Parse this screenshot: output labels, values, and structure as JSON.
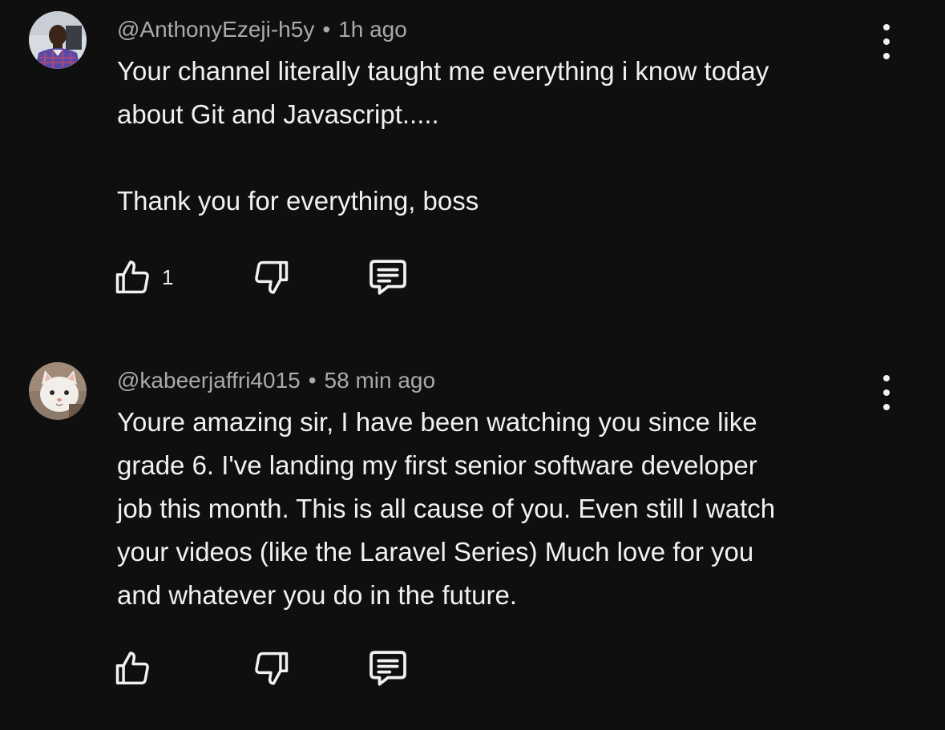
{
  "comments": [
    {
      "handle": "@AnthonyEzeji-h5y",
      "separator": "•",
      "time": "1h ago",
      "text": "Your channel literally taught me everything i know today\nabout Git and Javascript.....\n\nThank you for everything, boss",
      "like_count": "1",
      "avatar_icon": "person-photo",
      "actions": [
        "like-icon",
        "dislike-icon",
        "reply-icon"
      ]
    },
    {
      "handle": "@kabeerjaffri4015",
      "separator": "•",
      "time": "58 min ago",
      "text": "Youre amazing sir, I have been watching you since like\ngrade 6. I've landing my first senior software developer\njob this month. This is all cause of you. Even still I watch\nyour videos (like the Laravel Series) Much love for you\nand whatever you do in the future.",
      "like_count": "",
      "avatar_icon": "cat-photo",
      "actions": [
        "like-icon",
        "dislike-icon",
        "reply-icon"
      ]
    }
  ],
  "colors": {
    "background": "#0f0f0f",
    "text": "#f1f1f1",
    "meta": "#aaaaaa"
  }
}
